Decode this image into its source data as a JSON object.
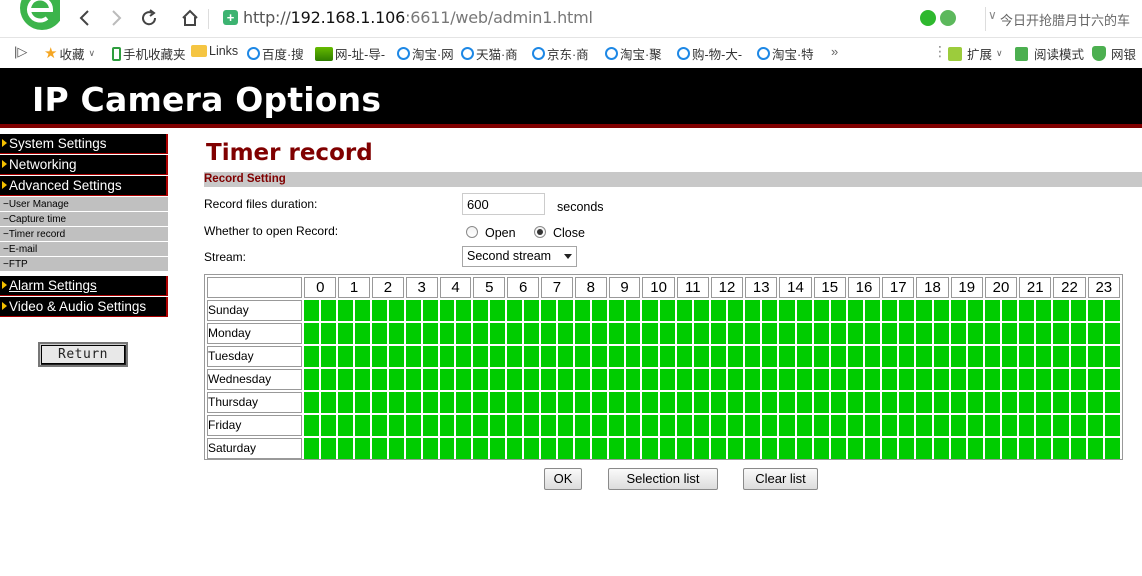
{
  "browser": {
    "url_prefix": "http://",
    "url_host": "192.168.1.106",
    "url_rest": ":6611/web/admin1.html",
    "news_text": "今日开抢腊月廿六的车",
    "logo_color": "#3cb44b"
  },
  "bookmarks": {
    "favorites": "收藏",
    "mobile": "手机收藏夹",
    "links": "Links",
    "items": [
      "百度·搜",
      "网-址-导-",
      "淘宝·网",
      "天猫·商",
      "京东·商",
      "淘宝·聚",
      "购-物-大-",
      "淘宝·特"
    ],
    "more": "»",
    "extensions": "扩展",
    "reading_mode": "阅读模式",
    "netbank": "网银"
  },
  "header": {
    "title": "IP Camera Options"
  },
  "sidebar": {
    "system": "System Settings",
    "networking": "Networking",
    "advanced": "Advanced Settings",
    "sub": [
      "−User Manage",
      "−Capture time",
      "−Timer record",
      "−E-mail",
      "−FTP"
    ],
    "alarm": "Alarm Settings",
    "video": "Video & Audio Settings",
    "return_label": "Return"
  },
  "main": {
    "title": "Timer record",
    "section": "Record Setting",
    "duration_label": "Record files duration:",
    "duration_value": "600",
    "duration_unit": "seconds",
    "open_record_label": "Whether to open Record:",
    "open_label": "Open",
    "close_label": "Close",
    "record_state": "close",
    "stream_label": "Stream:",
    "stream_value": "Second stream",
    "days": [
      "Sunday",
      "Monday",
      "Tuesday",
      "Wednesday",
      "Thursday",
      "Friday",
      "Saturday"
    ],
    "hours": [
      "0",
      "1",
      "2",
      "3",
      "4",
      "5",
      "6",
      "7",
      "8",
      "9",
      "10",
      "11",
      "12",
      "13",
      "14",
      "15",
      "16",
      "17",
      "18",
      "19",
      "20",
      "21",
      "22",
      "23"
    ],
    "cell_color_selected": "#00cc00",
    "all_selected": true,
    "buttons": {
      "ok": "OK",
      "selection": "Selection list",
      "clear": "Clear list"
    }
  }
}
